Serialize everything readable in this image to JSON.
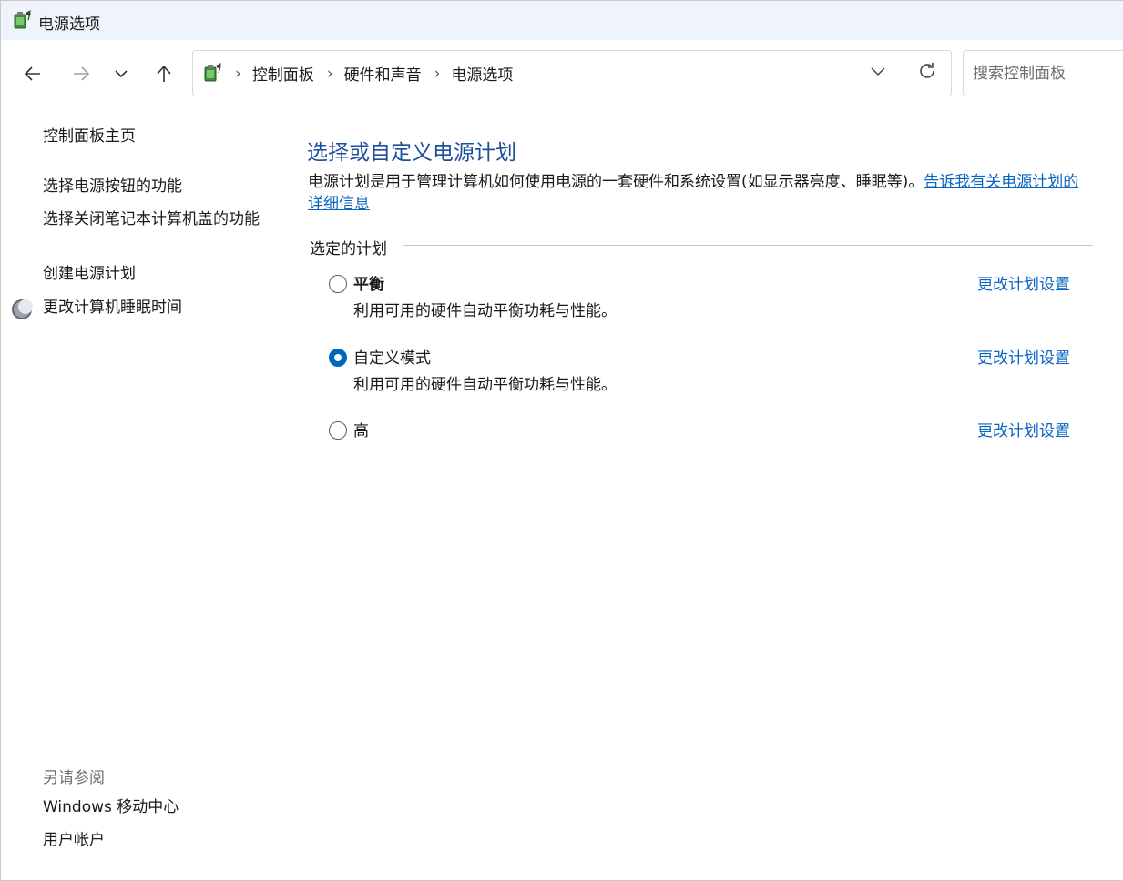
{
  "window": {
    "title": "电源选项",
    "icon": "power-options-icon"
  },
  "nav": {
    "back_icon": "arrow-left-icon",
    "forward_icon": "arrow-right-icon",
    "recent_icon": "chevron-down-icon",
    "up_icon": "arrow-up-icon",
    "breadcrumb": [
      "控制面板",
      "硬件和声音",
      "电源选项"
    ],
    "search_placeholder": "搜索控制面板"
  },
  "sidebar": {
    "home": "控制面板主页",
    "items": [
      "选择电源按钮的功能",
      "选择关闭笔记本计算机盖的功能",
      "创建电源计划",
      "更改计算机睡眠时间"
    ],
    "see_also_title": "另请参阅",
    "see_also": [
      "Windows 移动中心",
      "用户帐户"
    ]
  },
  "main": {
    "heading": "选择或自定义电源计划",
    "description": "电源计划是用于管理计算机如何使用电源的一套硬件和系统设置(如显示器亮度、睡眠等)。",
    "description_link": "告诉我有关电源计划的详细信息",
    "group_label": "选定的计划",
    "plans": [
      {
        "name": "平衡",
        "description": "利用可用的硬件自动平衡功耗与性能。",
        "link": "更改计划设置",
        "selected": false
      },
      {
        "name": "自定义模式",
        "description": "利用可用的硬件自动平衡功耗与性能。",
        "link": "更改计划设置",
        "selected": true
      },
      {
        "name": "高",
        "description": "",
        "link": "更改计划设置",
        "selected": false
      }
    ]
  },
  "colors": {
    "accent": "#0067c0",
    "link": "#0a64c2",
    "heading": "#1c4f9c",
    "titlebar": "#eff3fa"
  }
}
